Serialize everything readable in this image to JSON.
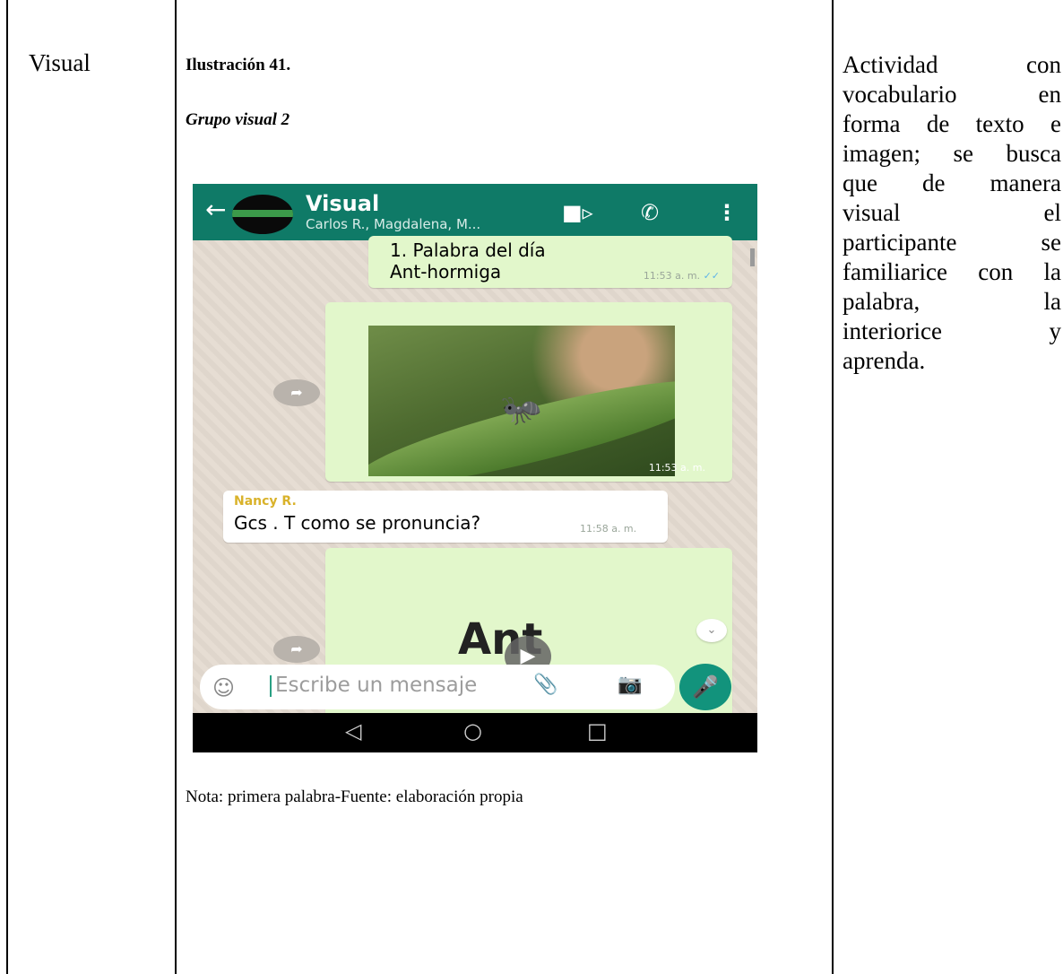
{
  "table": {
    "category": "Visual",
    "figure_number": "Ilustración  41.",
    "figure_title": "Grupo visual 2",
    "note": "Nota: primera palabra-Fuente: elaboración propia",
    "description_lines": [
      "Actividad con",
      "vocabulario en",
      "forma de texto e",
      "imagen; se busca",
      "que de manera",
      "visual el",
      "participante se",
      "familiarice con la",
      "palabra, la",
      "interiorice y",
      "aprenda."
    ]
  },
  "screenshot": {
    "app_bar": {
      "back_icon": "arrow-left-icon",
      "chat_name": "Visual",
      "members": "Carlos R., Magdalena, M...",
      "video_icon": "video-camera-icon",
      "call_icon": "phone-icon",
      "more_icon": "more-vert-icon"
    },
    "messages": [
      {
        "line1": "1. Palabra del día",
        "line2": "Ant-hormiga",
        "time": "11:53 a. m."
      },
      {
        "type": "image",
        "image_icon": "ant-on-leaf-photo",
        "time": "11:53 a. m."
      },
      {
        "sender": "Nancy R.",
        "text": "Gcs . T como se pronuncia?",
        "time": "11:58 a. m."
      },
      {
        "type": "image",
        "text": "Ant"
      }
    ],
    "input": {
      "placeholder": "Escribe un mensaje",
      "emoji_icon": "emoji-icon",
      "attach_icon": "paperclip-icon",
      "camera_icon": "camera-icon",
      "mic_icon": "microphone-icon"
    },
    "colors": {
      "header": "#0f7a67",
      "outgoing": "#e2f7cb",
      "sender_name": "#d9b22a",
      "mic": "#12937c"
    }
  }
}
